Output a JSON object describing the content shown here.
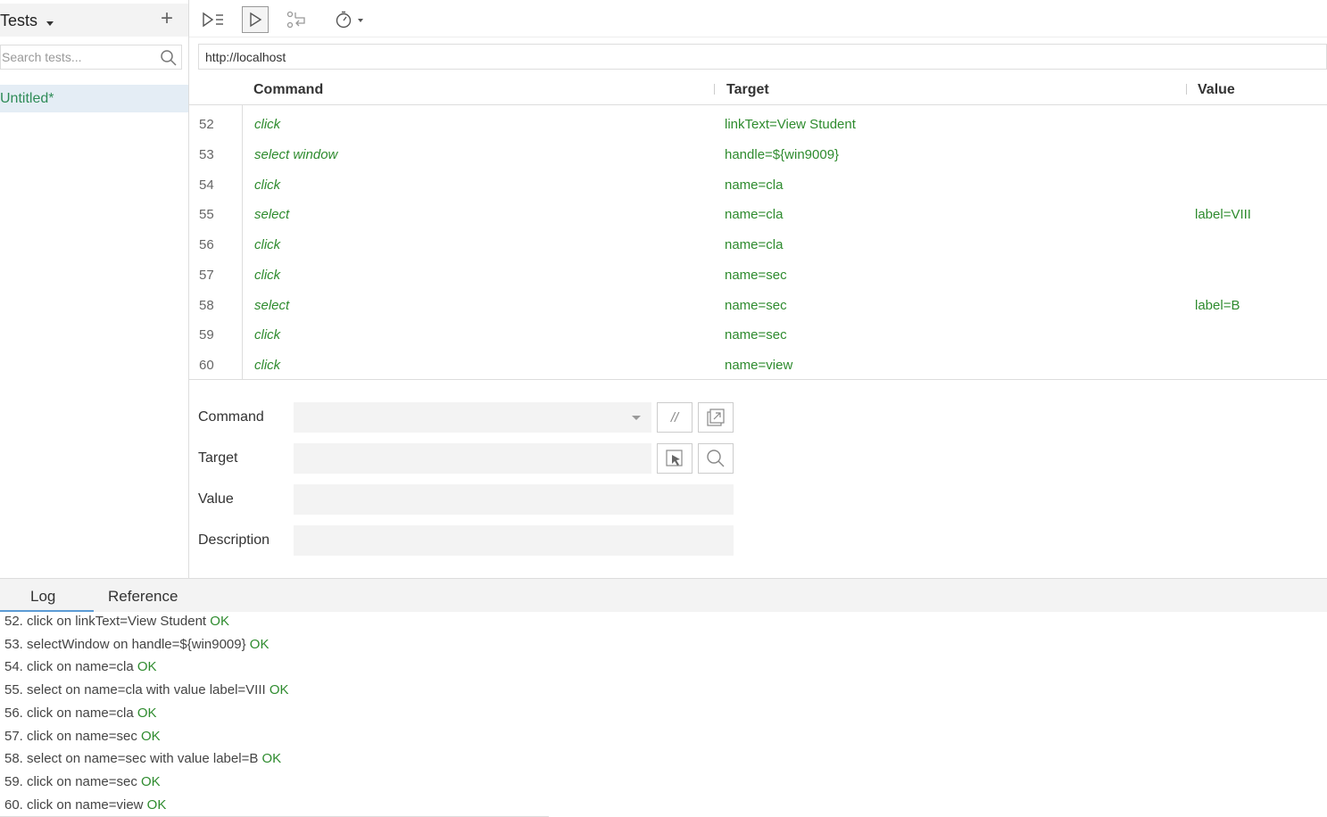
{
  "sidebar": {
    "title": "Tests",
    "add_icon": "plus-icon",
    "search_placeholder": "Search tests...",
    "search_icon": "search-icon",
    "tests": [
      {
        "label": "Untitled*"
      }
    ]
  },
  "toolbar": {
    "buttons": [
      {
        "icon": "run-all-tests-icon"
      },
      {
        "icon": "run-current-test-icon"
      },
      {
        "icon": "step-over-icon"
      },
      {
        "icon": "speed-timer-icon"
      }
    ]
  },
  "url": {
    "value": "http://localhost"
  },
  "table": {
    "headers": {
      "command": "Command",
      "target": "Target",
      "value": "Value"
    },
    "rows": [
      {
        "num": "52",
        "command": "click",
        "target": "linkText=View Student",
        "value": ""
      },
      {
        "num": "53",
        "command": "select window",
        "target": "handle=${win9009}",
        "value": ""
      },
      {
        "num": "54",
        "command": "click",
        "target": "name=cla",
        "value": ""
      },
      {
        "num": "55",
        "command": "select",
        "target": "name=cla",
        "value": "label=VIII"
      },
      {
        "num": "56",
        "command": "click",
        "target": "name=cla",
        "value": ""
      },
      {
        "num": "57",
        "command": "click",
        "target": "name=sec",
        "value": ""
      },
      {
        "num": "58",
        "command": "select",
        "target": "name=sec",
        "value": "label=B"
      },
      {
        "num": "59",
        "command": "click",
        "target": "name=sec",
        "value": ""
      },
      {
        "num": "60",
        "command": "click",
        "target": "name=view",
        "value": ""
      }
    ]
  },
  "editor": {
    "command_label": "Command",
    "target_label": "Target",
    "value_label": "Value",
    "description_label": "Description",
    "comment_button": "//",
    "open_reference_icon": "open-external-icon",
    "select_target_icon": "select-target-icon",
    "find_target_icon": "search-icon"
  },
  "bottom": {
    "tabs": [
      {
        "label": "Log"
      },
      {
        "label": "Reference"
      }
    ],
    "log": [
      {
        "text": "52. click on linkText=View Student ",
        "status": "OK"
      },
      {
        "text": "53. selectWindow on handle=${win9009} ",
        "status": "OK"
      },
      {
        "text": "54. click on name=cla ",
        "status": "OK"
      },
      {
        "text": "55. select on name=cla with value label=VIII ",
        "status": "OK"
      },
      {
        "text": "56. click on name=cla ",
        "status": "OK"
      },
      {
        "text": "57. click on name=sec ",
        "status": "OK"
      },
      {
        "text": "58. select on name=sec with value label=B ",
        "status": "OK"
      },
      {
        "text": "59. click on name=sec ",
        "status": "OK"
      },
      {
        "text": "60. click on name=view ",
        "status": "OK"
      }
    ]
  }
}
